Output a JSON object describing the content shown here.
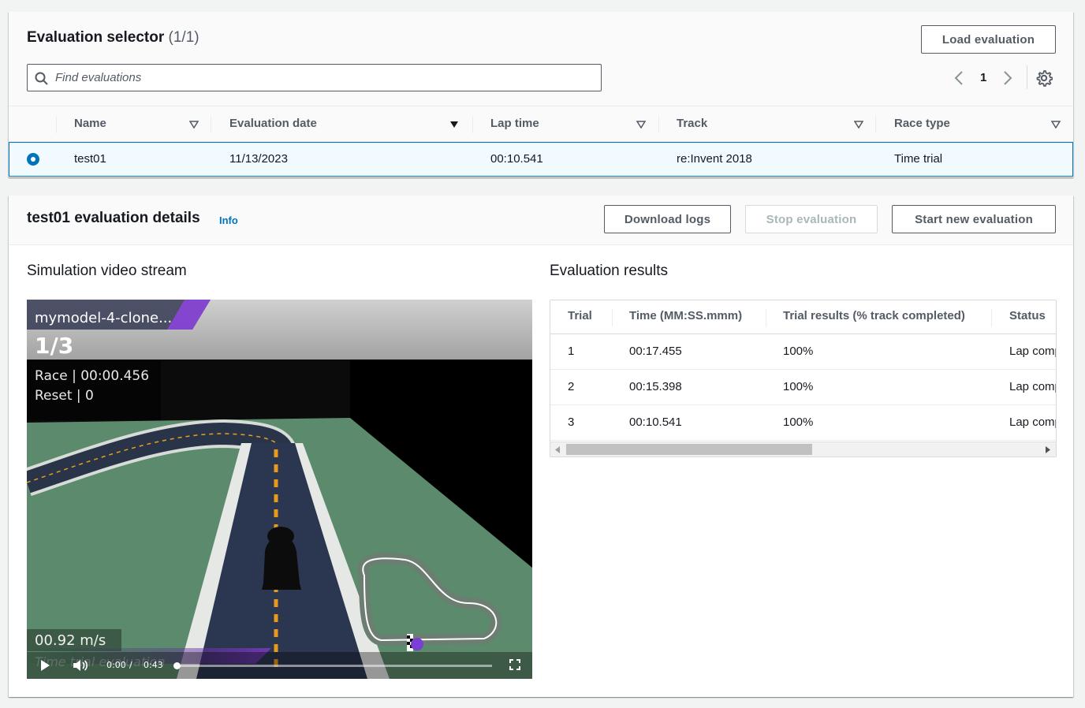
{
  "selector": {
    "title": "Evaluation selector",
    "count": "(1/1)",
    "load_button": "Load evaluation",
    "search_placeholder": "Find evaluations",
    "page": "1",
    "columns": [
      "Name",
      "Evaluation date",
      "Lap time",
      "Track",
      "Race type"
    ],
    "rows": [
      {
        "name": "test01",
        "date": "11/13/2023",
        "lap_time": "00:10.541",
        "track": "re:Invent 2018",
        "race_type": "Time trial",
        "selected": true
      }
    ]
  },
  "details": {
    "title": "test01 evaluation details",
    "info": "Info",
    "download_button": "Download logs",
    "stop_button": "Stop evaluation",
    "start_button": "Start new evaluation",
    "video_heading": "Simulation video stream",
    "results_heading": "Evaluation results"
  },
  "video": {
    "model_name": "mymodel-4-clone...",
    "lap": "1/3",
    "race": "Race | 00:00.456",
    "reset": "Reset | 0",
    "speed": "00.92 m/s",
    "mode": "Time trial evaluation",
    "current_time": "0:00",
    "time_sep": "/",
    "duration": "0:43",
    "progress": 0
  },
  "results": {
    "columns": [
      "Trial",
      "Time (MM:SS.mmm)",
      "Trial results (% track completed)",
      "Status"
    ],
    "rows": [
      {
        "trial": "1",
        "time": "00:17.455",
        "completed": "100%",
        "status": "Lap complete"
      },
      {
        "trial": "2",
        "time": "00:15.398",
        "completed": "100%",
        "status": "Lap complete"
      },
      {
        "trial": "3",
        "time": "00:10.541",
        "completed": "100%",
        "status": "Lap complete"
      }
    ]
  },
  "colors": {
    "accent": "#0073bb",
    "selected_row_bg": "#f1faff"
  },
  "icons": [
    "search-icon",
    "chevron-left-icon",
    "chevron-right-icon",
    "settings-icon",
    "sort-caret-icon",
    "play-icon",
    "volume-icon",
    "fullscreen-icon"
  ]
}
